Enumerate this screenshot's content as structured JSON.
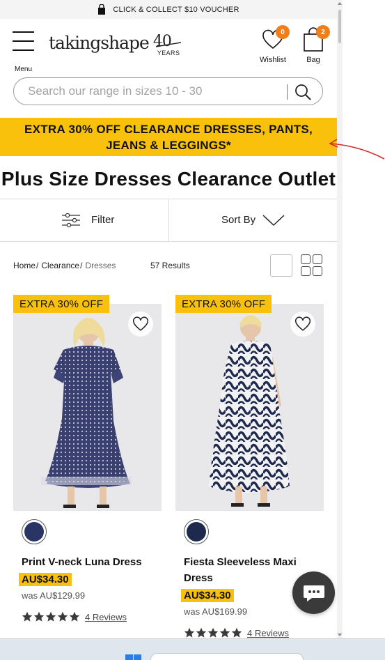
{
  "promo_strip": {
    "text": "CLICK & COLLECT $10 VOUCHER",
    "icon": "shopping-bag-icon"
  },
  "header": {
    "menu_label": "Menu",
    "logo_word": "takingshape",
    "logo_number": "40",
    "logo_years": "YEARS",
    "wishlist_label": "Wishlist",
    "wishlist_count": "0",
    "bag_label": "Bag",
    "bag_count": "2"
  },
  "search": {
    "placeholder": "Search our range in sizes 10 - 30"
  },
  "banner": {
    "text": "EXTRA 30% OFF CLEARANCE DRESSES, PANTS, JEANS & LEGGINGS*"
  },
  "page": {
    "title": "Plus Size Dresses Clearance Outlet"
  },
  "toolbar": {
    "filter_label": "Filter",
    "sort_label": "Sort By"
  },
  "breadcrumb": {
    "home": "Home",
    "clearance": "Clearance",
    "current": "Dresses",
    "separator": "/"
  },
  "results": "57 Results",
  "products": [
    {
      "tag": "EXTRA 30% OFF",
      "name": "Print V-neck Luna Dress",
      "price": "AU$34.30",
      "was": "was AU$129.99",
      "rating": 5,
      "reviews": "4 Reviews",
      "swatch_color": "#2b3565"
    },
    {
      "tag": "EXTRA 30% OFF",
      "name": "Fiesta Sleeveless Maxi Dress",
      "price": "AU$34.30",
      "was": "was AU$169.99",
      "rating": 5,
      "reviews": "4 Reviews",
      "swatch_color": "#1e2a4d"
    }
  ],
  "colors": {
    "accent": "#f9c10b",
    "badge": "#f07f1a",
    "chat": "#3a3a3a"
  }
}
